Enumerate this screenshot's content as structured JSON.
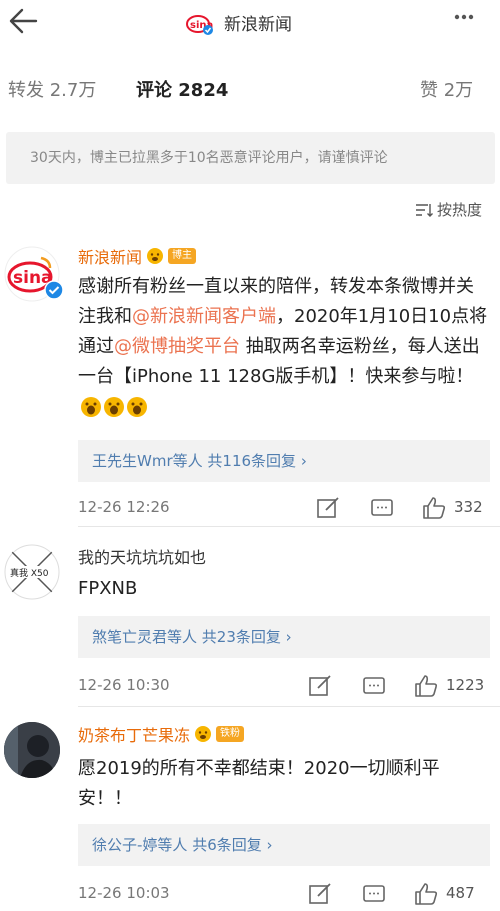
{
  "header": {
    "title": "新浪新闻",
    "back_icon": "back-arrow-icon",
    "more_icon": "more-dots-icon"
  },
  "tabs": [
    {
      "label": "转发",
      "count": "2.7万"
    },
    {
      "label": "评论",
      "count": "2824"
    },
    {
      "label": "赞",
      "count": "2万"
    }
  ],
  "notice": "30天内，博主已拉黑多于10名恶意评论用户，请谨慎评论",
  "sort_label": "按热度",
  "colors": {
    "accent": "#eb7350",
    "vip_name": "#e86b0a",
    "link_blue": "#507daf",
    "badge": "#f5a623"
  },
  "comments": [
    {
      "name": "新浪新闻",
      "badge": "博主",
      "text_parts": [
        "感谢所有粉丝一直以来的陪伴，转发本条微博并关注我和",
        "@新浪新闻客户端",
        "，2020年1月10日10点将通过",
        "@微博抽奖平台",
        " 抽取两名幸运粉丝，每人送出一台【iPhone 11 128G版手机】！快来参与啦！"
      ],
      "replies_who": "王先生Wmr等人",
      "replies_count": "共116条回复",
      "time": "12-26 12:26",
      "likes": "332"
    },
    {
      "name": "我的天坑坑坑如也",
      "avatar_text": "真我 X50",
      "text": "FPXNB",
      "replies_who": "煞笔亡灵君等人",
      "replies_count": "共23条回复",
      "time": "12-26 10:30",
      "likes": "1223"
    },
    {
      "name": "奶茶布丁芒果冻",
      "badge": "铁粉",
      "text": "愿2019的所有不幸都结束！2020一切顺利平安！！",
      "replies_who": "徐公子-婷等人",
      "replies_count": "共6条回复",
      "time": "12-26 10:03",
      "likes": "487"
    }
  ]
}
